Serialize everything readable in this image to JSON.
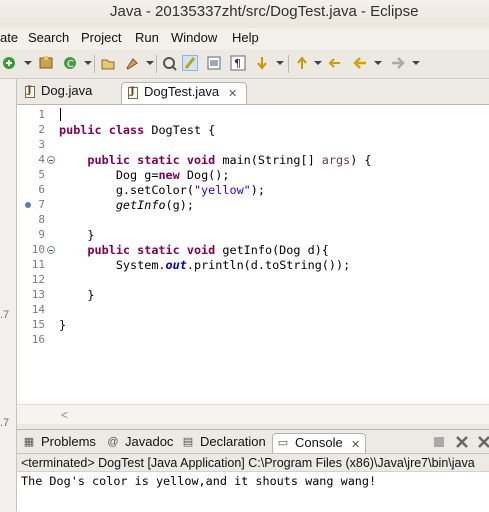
{
  "window": {
    "title": "Java - 20135337zht/src/DogTest.java - Eclipse"
  },
  "menu": [
    "ate",
    "Search",
    "Project",
    "Run",
    "Window",
    "Help"
  ],
  "left_strip_marks": [
    ".7",
    ".7"
  ],
  "editor_tabs": [
    {
      "label": "Dog.java",
      "active": false
    },
    {
      "label": "DogTest.java",
      "active": true,
      "close": "✕"
    }
  ],
  "code": {
    "line_numbers": [
      "1",
      "2",
      "3",
      "4",
      "5",
      "6",
      "7",
      "8",
      "9",
      "10",
      "11",
      "12",
      "13",
      "14",
      "15",
      "16"
    ],
    "lines": [
      {
        "n": "1",
        "parts": []
      },
      {
        "n": "2",
        "parts": [
          {
            "t": "public class ",
            "c": "kw"
          },
          {
            "t": "DogTest {",
            "c": ""
          }
        ]
      },
      {
        "n": "3",
        "parts": []
      },
      {
        "n": "4",
        "parts": [
          {
            "t": "    public static void ",
            "c": "kw"
          },
          {
            "t": "main(String[] ",
            "c": ""
          },
          {
            "t": "args",
            "c": "param"
          },
          {
            "t": ") {",
            "c": ""
          }
        ]
      },
      {
        "n": "5",
        "parts": [
          {
            "t": "        Dog g=",
            "c": ""
          },
          {
            "t": "new ",
            "c": "kw"
          },
          {
            "t": "Dog();",
            "c": ""
          }
        ]
      },
      {
        "n": "6",
        "parts": [
          {
            "t": "        g.setColor(",
            "c": ""
          },
          {
            "t": "\"yellow\"",
            "c": "str"
          },
          {
            "t": ");",
            "c": ""
          }
        ]
      },
      {
        "n": "7",
        "parts": [
          {
            "t": "        ",
            "c": ""
          },
          {
            "t": "getInfo",
            "c": "it"
          },
          {
            "t": "(g);",
            "c": ""
          }
        ]
      },
      {
        "n": "8",
        "parts": []
      },
      {
        "n": "9",
        "parts": [
          {
            "t": "    }",
            "c": ""
          }
        ]
      },
      {
        "n": "10",
        "parts": [
          {
            "t": "    public static void ",
            "c": "kw"
          },
          {
            "t": "getInfo(Dog d){",
            "c": ""
          }
        ]
      },
      {
        "n": "11",
        "parts": [
          {
            "t": "        System.",
            "c": ""
          },
          {
            "t": "out",
            "c": "fld"
          },
          {
            "t": ".println(d.toString());",
            "c": ""
          }
        ]
      },
      {
        "n": "12",
        "parts": []
      },
      {
        "n": "13",
        "parts": [
          {
            "t": "    }",
            "c": ""
          }
        ]
      },
      {
        "n": "14",
        "parts": []
      },
      {
        "n": "15",
        "parts": [
          {
            "t": "}",
            "c": ""
          }
        ]
      },
      {
        "n": "16",
        "parts": []
      }
    ]
  },
  "scroll_arrow": "<",
  "bottom_tabs": [
    {
      "label": "Problems",
      "icon": "problems-icon",
      "glyph": "▦"
    },
    {
      "label": "Javadoc",
      "icon": "javadoc-icon",
      "glyph": "@"
    },
    {
      "label": "Declaration",
      "icon": "declaration-icon",
      "glyph": "▤"
    },
    {
      "label": "Console",
      "icon": "console-icon",
      "glyph": "▭",
      "active": true,
      "close": "✕"
    }
  ],
  "console": {
    "terminated": "<terminated> DogTest [Java Application] C:\\Program Files (x86)\\Java\\jre7\\bin\\java",
    "output": "The Dog's color is yellow,and it shouts wang wang!"
  },
  "colors": {
    "keyword": "#7f0055",
    "string": "#2a00ff",
    "field": "#0000c0",
    "accent": "#dceaf9"
  }
}
